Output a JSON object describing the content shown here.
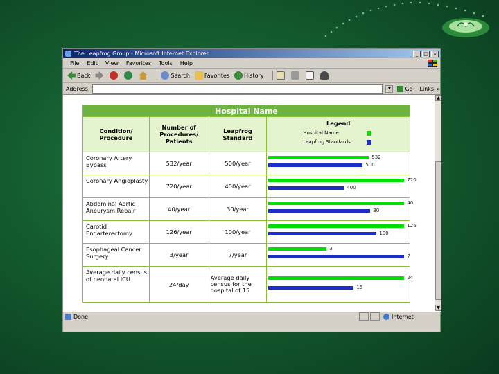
{
  "browser": {
    "title": "The Leapfrog Group - Microsoft Internet Explorer",
    "menu": [
      "File",
      "Edit",
      "View",
      "Favorites",
      "Tools",
      "Help"
    ],
    "toolbar": {
      "back": "Back",
      "search": "Search",
      "favorites": "Favorites",
      "history": "History"
    },
    "address_label": "Address",
    "address_value": "",
    "go_label": "Go",
    "links_label": "Links",
    "status_text": "Done",
    "zone_text": "Internet"
  },
  "table": {
    "banner": "Hospital Name",
    "headers": {
      "condition": "Condition/ Procedure",
      "number": "Number of Procedures/ Patients",
      "standard": "Leapfrog Standard",
      "legend": "Legend"
    },
    "legend": [
      {
        "label": "Hospital Name",
        "color": "#00e000"
      },
      {
        "label": "Leapfrog Standards",
        "color": "#1c2fc8"
      }
    ],
    "rows": [
      {
        "condition": "Coronary Artery Bypass",
        "number": "532/year",
        "standard": "500/year",
        "hospital": 532,
        "leapfrog": 500,
        "hospital_label": "532",
        "leapfrog_label": "500"
      },
      {
        "condition": "Coronary Angioplasty",
        "number": "720/year",
        "standard": "400/year",
        "hospital": 720,
        "leapfrog": 400,
        "hospital_label": "720",
        "leapfrog_label": "400"
      },
      {
        "condition": "Abdominal Aortic Aneurysm Repair",
        "number": "40/year",
        "standard": "30/year",
        "hospital": 40,
        "leapfrog": 30,
        "hospital_label": "40",
        "leapfrog_label": "30"
      },
      {
        "condition": "Carotid Endarterectomy",
        "number": "126/year",
        "standard": "100/year",
        "hospital": 126,
        "leapfrog": 100,
        "hospital_label": "126",
        "leapfrog_label": "100"
      },
      {
        "condition": "Esophageal Cancer Surgery",
        "number": "3/year",
        "standard": "7/year",
        "hospital": 3,
        "leapfrog": 7,
        "hospital_label": "3",
        "leapfrog_label": "7"
      },
      {
        "condition": "Average daily census of neonatal ICU",
        "number": "24/day",
        "standard": "Average daily census for the hospital of 15",
        "hospital": 24,
        "leapfrog": 15,
        "hospital_label": "24",
        "leapfrog_label": "15"
      }
    ]
  },
  "colors": {
    "hospital_bar": "#00e000",
    "leapfrog_bar": "#1c2fc8",
    "banner": "#6db33f",
    "header_bg": "#e4f4cf"
  }
}
